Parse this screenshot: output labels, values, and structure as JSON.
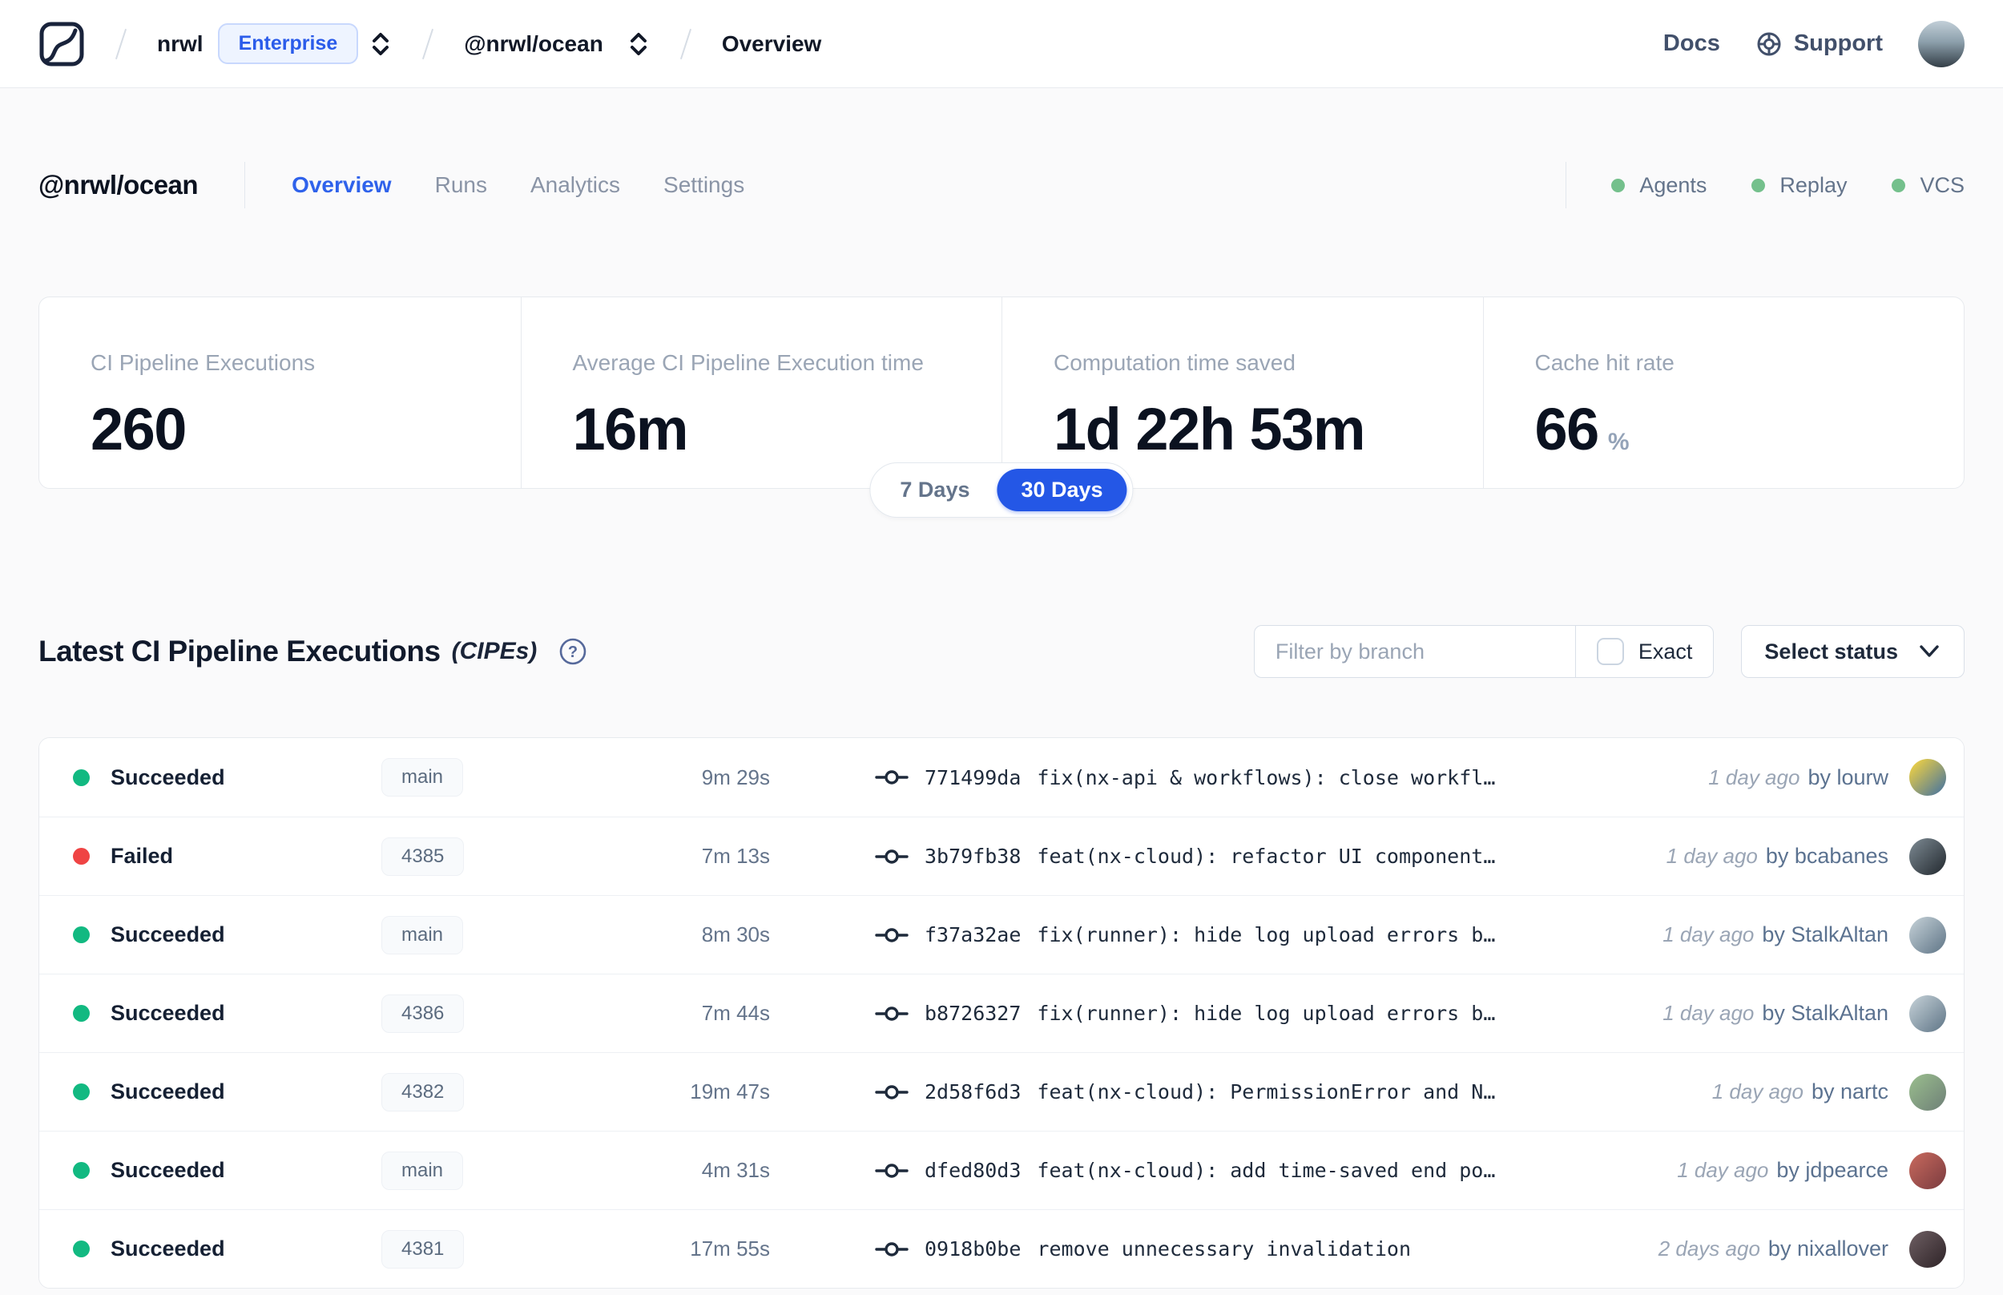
{
  "topnav": {
    "breadcrumb": {
      "org": "nrwl",
      "org_badge": "Enterprise",
      "project": "@nrwl/ocean",
      "page": "Overview"
    },
    "docs_label": "Docs",
    "support_label": "Support"
  },
  "workspace": {
    "title": "@nrwl/ocean",
    "tabs": [
      {
        "label": "Overview",
        "active": true
      },
      {
        "label": "Runs",
        "active": false
      },
      {
        "label": "Analytics",
        "active": false
      },
      {
        "label": "Settings",
        "active": false
      }
    ],
    "services": [
      {
        "label": "Agents"
      },
      {
        "label": "Replay"
      },
      {
        "label": "VCS"
      }
    ]
  },
  "stats": {
    "cards": [
      {
        "label": "CI Pipeline Executions",
        "value": "260",
        "suffix": ""
      },
      {
        "label": "Average CI Pipeline Execution time",
        "value": "16m",
        "suffix": ""
      },
      {
        "label": "Computation time saved",
        "value": "1d 22h 53m",
        "suffix": ""
      },
      {
        "label": "Cache hit rate",
        "value": "66",
        "suffix": "%"
      }
    ],
    "range_toggle": {
      "options": [
        "7 Days",
        "30 Days"
      ],
      "selected": "30 Days"
    }
  },
  "cipe": {
    "title": "Latest CI Pipeline Executions",
    "title_suffix": "(CIPEs)",
    "filter": {
      "placeholder": "Filter by branch",
      "exact_label": "Exact",
      "status_label": "Select status"
    },
    "rows": [
      {
        "status": "Succeeded",
        "status_color": "#12B981",
        "branch": "main",
        "duration": "9m 29s",
        "commit_hash": "771499da",
        "commit_message": "fix(nx-api & workflows): close workfl…",
        "time_ago": "1 day ago",
        "author": "by lourw",
        "avatar_colors": [
          "#FFD93B",
          "#3E6FA3"
        ]
      },
      {
        "status": "Failed",
        "status_color": "#EF4444",
        "branch": "4385",
        "duration": "7m 13s",
        "commit_hash": "3b79fb38",
        "commit_message": "feat(nx-cloud): refactor UI component…",
        "time_ago": "1 day ago",
        "author": "by bcabanes",
        "avatar_colors": [
          "#7E8B94",
          "#22282E"
        ]
      },
      {
        "status": "Succeeded",
        "status_color": "#12B981",
        "branch": "main",
        "duration": "8m 30s",
        "commit_hash": "f37a32ae",
        "commit_message": "fix(runner): hide log upload errors b…",
        "time_ago": "1 day ago",
        "author": "by StalkAltan",
        "avatar_colors": [
          "#C7D3D9",
          "#5E7486"
        ]
      },
      {
        "status": "Succeeded",
        "status_color": "#12B981",
        "branch": "4386",
        "duration": "7m 44s",
        "commit_hash": "b8726327",
        "commit_message": "fix(runner): hide log upload errors b…",
        "time_ago": "1 day ago",
        "author": "by StalkAltan",
        "avatar_colors": [
          "#C7D3D9",
          "#5E7486"
        ]
      },
      {
        "status": "Succeeded",
        "status_color": "#12B981",
        "branch": "4382",
        "duration": "19m 47s",
        "commit_hash": "2d58f6d3",
        "commit_message": "feat(nx-cloud): PermissionError and N…",
        "time_ago": "1 day ago",
        "author": "by nartc",
        "avatar_colors": [
          "#9BBF8E",
          "#6E7F77"
        ]
      },
      {
        "status": "Succeeded",
        "status_color": "#12B981",
        "branch": "main",
        "duration": "4m 31s",
        "commit_hash": "dfed80d3",
        "commit_message": "feat(nx-cloud): add time-saved end po…",
        "time_ago": "1 day ago",
        "author": "by jdpearce",
        "avatar_colors": [
          "#C96A5E",
          "#7A3B3F"
        ]
      },
      {
        "status": "Succeeded",
        "status_color": "#12B981",
        "branch": "4381",
        "duration": "17m 55s",
        "commit_hash": "0918b0be",
        "commit_message": "remove unnecessary invalidation",
        "time_ago": "2 days ago",
        "author": "by nixallover",
        "avatar_colors": [
          "#6E5F63",
          "#2E2327"
        ]
      }
    ]
  },
  "colors": {
    "accent_blue": "#2457E6",
    "tab_active_blue": "#2F62EB",
    "succeeded_green": "#12B981",
    "failed_red": "#EF4444",
    "service_green": "#74C08C"
  }
}
